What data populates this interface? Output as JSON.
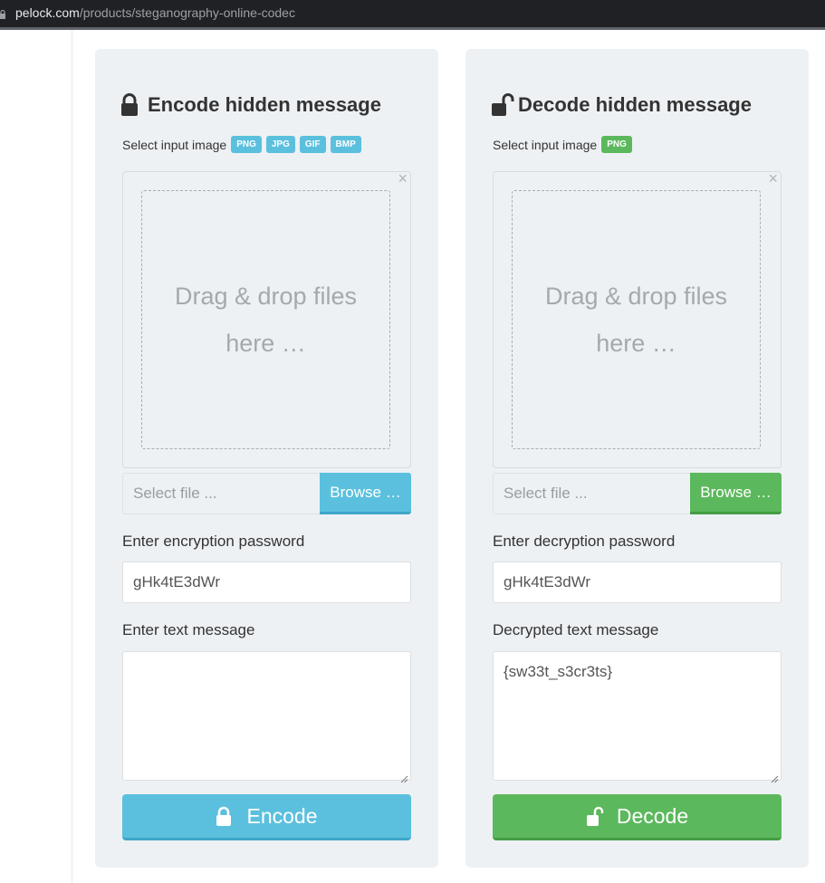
{
  "browser": {
    "url_domain": "pelock.com",
    "url_path": "/products/steganography-online-codec"
  },
  "encode": {
    "title": "Encode hidden message",
    "title_icon": "lock-icon",
    "select_label": "Select input image",
    "formats": [
      "PNG",
      "JPG",
      "GIF",
      "BMP"
    ],
    "dropzone_text": "Drag & drop files here …",
    "file_placeholder": "Select file ...",
    "browse_label": "Browse …",
    "password_label": "Enter encryption password",
    "password_value": "gHk4tE3dWr",
    "message_label": "Enter text message",
    "message_value": "",
    "button_label": "Encode",
    "accent": "#5bc0de"
  },
  "decode": {
    "title": "Decode hidden message",
    "title_icon": "unlock-icon",
    "select_label": "Select input image",
    "formats": [
      "PNG"
    ],
    "dropzone_text": "Drag & drop files here …",
    "file_placeholder": "Select file ...",
    "browse_label": "Browse …",
    "password_label": "Enter decryption password",
    "password_value": "gHk4tE3dWr",
    "message_label": "Decrypted text message",
    "message_value": "{sw33t_s3cr3ts}",
    "button_label": "Decode",
    "accent": "#5cb85c"
  }
}
